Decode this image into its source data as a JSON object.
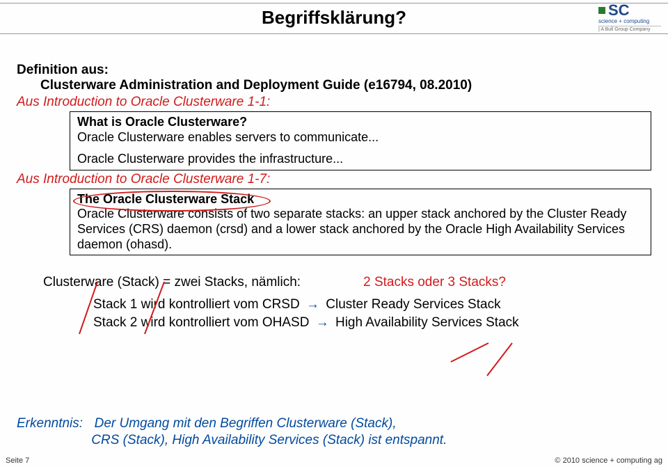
{
  "page": {
    "title": "Begriffsklärung?",
    "footer_left": "Seite 7",
    "footer_right": "© 2010 science + computing ag"
  },
  "logo": {
    "initials": "SC",
    "sub": "science + computing",
    "bull": "| A Bull Group Company"
  },
  "def": {
    "label": "Definition aus:",
    "source": "Clusterware Administration and Deployment Guide (e16794, 08.2010)"
  },
  "intro11": "Aus Introduction to Oracle Clusterware 1-1:",
  "box1": {
    "q": "What is Oracle Clusterware?",
    "l1": "Oracle Clusterware enables servers to communicate...",
    "l2": "Oracle Clusterware provides the infrastructure..."
  },
  "intro17": "Aus Introduction to Oracle Clusterware 1-7:",
  "box2": {
    "t": "The Oracle Clusterware Stack",
    "p": "Oracle Clusterware consists of two separate stacks: an upper stack anchored by the Cluster Ready Services (CRS) daemon (crsd) and a lower stack anchored by the Oracle High Availability Services daemon (ohasd)."
  },
  "cw": {
    "line": "Clusterware (Stack) = zwei Stacks, nämlich:",
    "q": "2 Stacks oder 3 Stacks?"
  },
  "s1": {
    "a": "Stack 1 wird kontrolliert vom CRSD",
    "b": "Cluster Ready Services Stack"
  },
  "s2": {
    "a": "Stack 2 wird kontrolliert vom OHASD",
    "b": "High Availability Services Stack"
  },
  "erkenntnis": {
    "label": "Erkenntnis:",
    "text1": "Der Umgang mit den Begriffen Clusterware (Stack),",
    "text2": "CRS (Stack), High Availability Services (Stack) ist entspannt."
  }
}
